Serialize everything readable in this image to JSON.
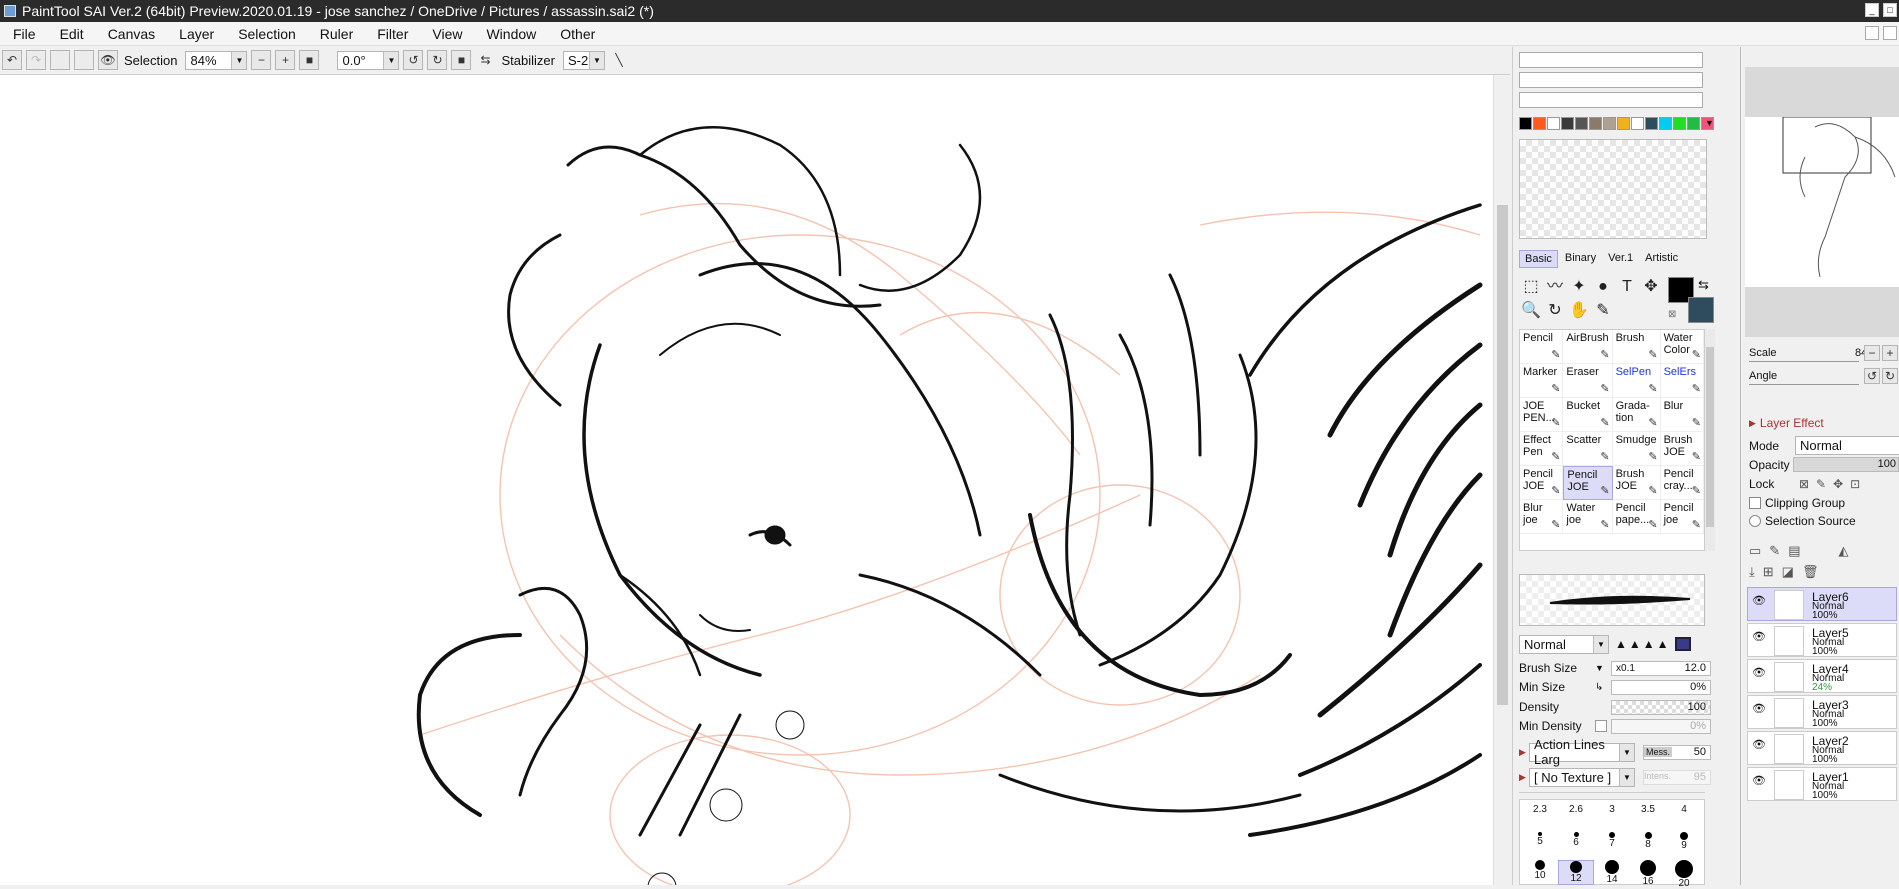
{
  "window": {
    "title": "PaintTool SAI Ver.2 (64bit) Preview.2020.01.19 - jose sanchez / OneDrive / Pictures / assassin.sai2 (*)"
  },
  "menu": [
    "File",
    "Edit",
    "Canvas",
    "Layer",
    "Selection",
    "Ruler",
    "Filter",
    "View",
    "Window",
    "Other"
  ],
  "toolbar": {
    "selection_label": "Selection",
    "zoom": "84%",
    "angle": "0.0°",
    "stabilizer_label": "Stabilizer",
    "stabilizer": "S-2"
  },
  "palette": {
    "swatches": [
      "#000000",
      "#ff5a1e",
      "#ffffff",
      "#3a3a3a",
      "#555555",
      "#8a7a6a",
      "#b0a090",
      "#f0b020",
      "#ffffff",
      "#2d4d5f",
      "#00ccee",
      "#22dd22",
      "#22bb44",
      "#ee5577"
    ]
  },
  "tool_tabs": [
    "Basic",
    "Binary",
    "Ver.1",
    "Artistic"
  ],
  "tool_icons": [
    "marquee-icon",
    "lasso-icon",
    "magic-wand-icon",
    "shape-icon",
    "text-icon",
    "move-icon",
    "zoom-icon",
    "rotate-icon",
    "hand-icon",
    "eyedropper-icon"
  ],
  "tool_glyphs": [
    "⬚",
    "〰",
    "✦",
    "●",
    "T",
    "✥",
    "🔍",
    "↻",
    "✋",
    "✎"
  ],
  "colors": {
    "foreground": "#000000",
    "background": "#2d4d5f"
  },
  "brushes": [
    {
      "line1": "Pencil",
      "line2": "",
      "blue": false,
      "sel": false
    },
    {
      "line1": "AirBrush",
      "line2": "",
      "blue": false,
      "sel": false
    },
    {
      "line1": "Brush",
      "line2": "",
      "blue": false,
      "sel": false
    },
    {
      "line1": "Water",
      "line2": "Color",
      "blue": false,
      "sel": false
    },
    {
      "line1": "Marker",
      "line2": "",
      "blue": false,
      "sel": false
    },
    {
      "line1": "Eraser",
      "line2": "",
      "blue": false,
      "sel": false
    },
    {
      "line1": "SelPen",
      "line2": "",
      "blue": true,
      "sel": false
    },
    {
      "line1": "SelErs",
      "line2": "",
      "blue": true,
      "sel": false
    },
    {
      "line1": "JOE",
      "line2": "PEN...",
      "blue": false,
      "sel": false
    },
    {
      "line1": "Bucket",
      "line2": "",
      "blue": false,
      "sel": false
    },
    {
      "line1": "Grada-",
      "line2": "tion",
      "blue": false,
      "sel": false
    },
    {
      "line1": "Blur",
      "line2": "",
      "blue": false,
      "sel": false
    },
    {
      "line1": "Effect",
      "line2": "Pen",
      "blue": false,
      "sel": false
    },
    {
      "line1": "Scatter",
      "line2": "",
      "blue": false,
      "sel": false
    },
    {
      "line1": "Smudge",
      "line2": "",
      "blue": false,
      "sel": false
    },
    {
      "line1": "Brush",
      "line2": "JOE",
      "blue": false,
      "sel": false
    },
    {
      "line1": "Pencil",
      "line2": "JOE",
      "blue": false,
      "sel": false
    },
    {
      "line1": "Pencil",
      "line2": "JOE",
      "blue": false,
      "sel": true
    },
    {
      "line1": "Brush",
      "line2": "JOE",
      "blue": false,
      "sel": false
    },
    {
      "line1": "Pencil",
      "line2": "cray...",
      "blue": false,
      "sel": false
    },
    {
      "line1": "Blur",
      "line2": "joe",
      "blue": false,
      "sel": false
    },
    {
      "line1": "Water",
      "line2": "joe",
      "blue": false,
      "sel": false
    },
    {
      "line1": "Pencil",
      "line2": "pape...",
      "blue": false,
      "sel": false
    },
    {
      "line1": "Pencil",
      "line2": "joe",
      "blue": false,
      "sel": false
    }
  ],
  "brush_props": {
    "blend_mode": "Normal",
    "size_label": "Brush Size",
    "size_mult": "x0.1",
    "size": "12.0",
    "min_size_label": "Min Size",
    "min_size": "0%",
    "density_label": "Density",
    "density": "100",
    "min_density_label": "Min Density",
    "min_density": "0%",
    "shape": "Action Lines Larg",
    "mess_label": "Mess.",
    "mess": "50",
    "texture": "[ No Texture ]",
    "intens_label": "Intens.",
    "intens": "95"
  },
  "brush_sizes": {
    "row1": [
      "2.3",
      "2.6",
      "3",
      "3.5",
      "4"
    ],
    "row2": [
      "5",
      "6",
      "7",
      "8",
      "9"
    ],
    "row3": [
      "10",
      "12",
      "14",
      "16",
      "20"
    ]
  },
  "navigator": {
    "scale_label": "Scale",
    "scale": "84%",
    "angle_label": "Angle",
    "angle": "0°"
  },
  "layer_effect": {
    "title": "Layer Effect",
    "mode_label": "Mode",
    "mode": "Normal",
    "opacity_label": "Opacity",
    "opacity": "100",
    "lock_label": "Lock",
    "clipping": "Clipping Group",
    "selection_source": "Selection Source"
  },
  "layers": [
    {
      "name": "Layer6",
      "mode": "Normal",
      "opacity": "100%",
      "selected": true,
      "green": false
    },
    {
      "name": "Layer5",
      "mode": "Normal",
      "opacity": "100%",
      "selected": false,
      "green": false
    },
    {
      "name": "Layer4",
      "mode": "Normal",
      "opacity": "24%",
      "selected": false,
      "green": true
    },
    {
      "name": "Layer3",
      "mode": "Normal",
      "opacity": "100%",
      "selected": false,
      "green": false
    },
    {
      "name": "Layer2",
      "mode": "Normal",
      "opacity": "100%",
      "selected": false,
      "green": false
    },
    {
      "name": "Layer1",
      "mode": "Normal",
      "opacity": "100%",
      "selected": false,
      "green": false
    }
  ]
}
